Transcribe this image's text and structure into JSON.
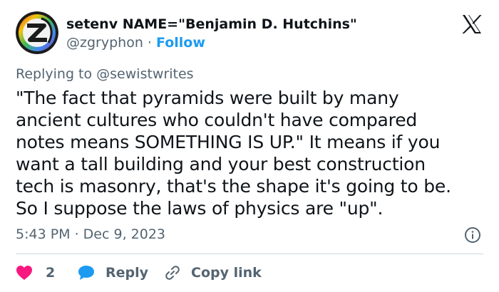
{
  "author": {
    "display_name": "setenv NAME=\"Benjamin D. Hutchins\"",
    "handle": "@zgryphon",
    "separator": " · ",
    "follow_label": "Follow"
  },
  "reply_to": {
    "prefix": "Replying to ",
    "mention": "@sewistwrites"
  },
  "tweet": {
    "lines": [
      "\"The fact that pyramids were built by many",
      "ancient cultures who couldn't have compared",
      "notes means SOMETHING IS UP.\" It means if you",
      "want a tall building and your best construction",
      "tech is masonry, that's the shape it's going to be.",
      "So I suppose the laws of physics are \"up\"."
    ]
  },
  "meta": {
    "timestamp": "5:43 PM · Dec 9, 2023"
  },
  "actions": {
    "like_count": "2",
    "reply_label": "Reply",
    "copy_label": "Copy link"
  },
  "icons": {
    "brand": "x-logo-icon",
    "info": "info-icon",
    "like": "heart-icon",
    "reply": "comment-bubble-icon",
    "copy": "link-icon"
  },
  "colors": {
    "accent": "#1d9bf0",
    "like": "#f91880",
    "text": "#0f1419",
    "muted": "#536471"
  }
}
